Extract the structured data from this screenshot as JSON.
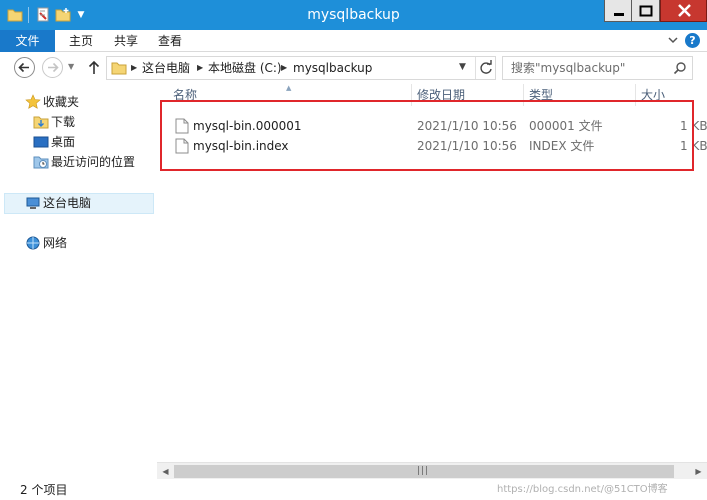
{
  "window": {
    "title": "mysqlbackup"
  },
  "ribbon": {
    "file": "文件",
    "home": "主页",
    "share": "共享",
    "view": "查看"
  },
  "address": {
    "crumbs": [
      "这台电脑",
      "本地磁盘 (C:)",
      "mysqlbackup"
    ]
  },
  "search": {
    "placeholder": "搜索\"mysqlbackup\""
  },
  "nav": {
    "favorites": "收藏夹",
    "downloads": "下载",
    "desktop": "桌面",
    "recent": "最近访问的位置",
    "thispc": "这台电脑",
    "network": "网络"
  },
  "columns": {
    "name": "名称",
    "date": "修改日期",
    "type": "类型",
    "size": "大小"
  },
  "files": [
    {
      "name": "mysql-bin.000001",
      "date": "2021/1/10 10:56",
      "type": "000001 文件",
      "size": "1 KB"
    },
    {
      "name": "mysql-bin.index",
      "date": "2021/1/10 10:56",
      "type": "INDEX 文件",
      "size": "1 KB"
    }
  ],
  "status": {
    "count": "2 个项目"
  },
  "watermark": "https://blog.csdn.net/@51CTO博客",
  "colors": {
    "titlebar": "#1e8fd9",
    "file_tab": "#1979ca",
    "close": "#c7372f",
    "highlight": "#e0262b"
  }
}
